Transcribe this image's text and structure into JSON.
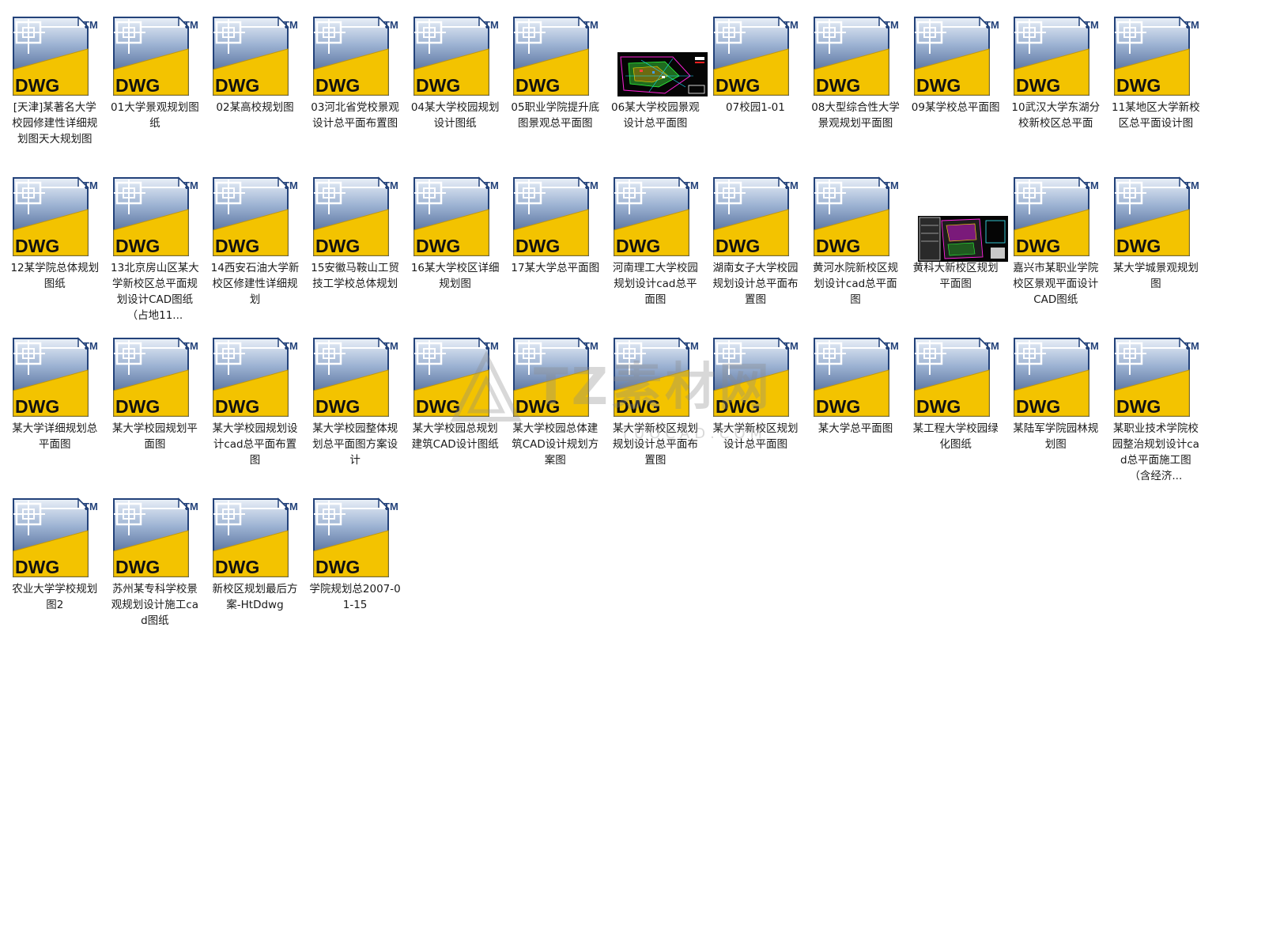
{
  "icon": {
    "badge": "DWG",
    "trademark": "TM",
    "accent": "#f3c300",
    "frame": "#29457a"
  },
  "files": [
    {
      "name": "[天津]某著名大学校园修建性详细规划图天大规划图",
      "thumb": false
    },
    {
      "name": "01大学景观规划图纸",
      "thumb": false
    },
    {
      "name": "02某高校规划图",
      "thumb": false
    },
    {
      "name": "03河北省党校景观设计总平面布置图",
      "thumb": false
    },
    {
      "name": "04某大学校园规划设计图纸",
      "thumb": false
    },
    {
      "name": "05职业学院提升底图景观总平面图",
      "thumb": false
    },
    {
      "name": "06某大学校园景观设计总平面图",
      "thumb": true
    },
    {
      "name": "07校园1-01",
      "thumb": false
    },
    {
      "name": "08大型综合性大学景观规划平面图",
      "thumb": false
    },
    {
      "name": "09某学校总平面图",
      "thumb": false
    },
    {
      "name": "10武汉大学东湖分校新校区总平面",
      "thumb": false
    },
    {
      "name": "11某地区大学新校区总平面设计图",
      "thumb": false
    },
    {
      "name": "12某学院总体规划图纸",
      "thumb": false
    },
    {
      "name": "13北京房山区某大学新校区总平面规划设计CAD图纸（占地11...",
      "thumb": false
    },
    {
      "name": "14西安石油大学新校区修建性详细规划",
      "thumb": false
    },
    {
      "name": "15安徽马鞍山工贸技工学校总体规划",
      "thumb": false
    },
    {
      "name": "16某大学校区详细规划图",
      "thumb": false
    },
    {
      "name": "17某大学总平面图",
      "thumb": false
    },
    {
      "name": "河南理工大学校园规划设计cad总平面图",
      "thumb": false
    },
    {
      "name": "湖南女子大学校园规划设计总平面布置图",
      "thumb": false
    },
    {
      "name": "黄河水院新校区规划设计cad总平面图",
      "thumb": false
    },
    {
      "name": "黄科大新校区规划平面图",
      "thumb": true
    },
    {
      "name": "嘉兴市某职业学院校区景观平面设计CAD图纸",
      "thumb": false
    },
    {
      "name": "某大学城景观规划图",
      "thumb": false
    },
    {
      "name": "某大学详细规划总平面图",
      "thumb": false
    },
    {
      "name": "某大学校园规划平面图",
      "thumb": false
    },
    {
      "name": "某大学校园规划设计cad总平面布置图",
      "thumb": false
    },
    {
      "name": "某大学校园整体规划总平面图方案设计",
      "thumb": false
    },
    {
      "name": "某大学校园总规划建筑CAD设计图纸",
      "thumb": false
    },
    {
      "name": "某大学校园总体建筑CAD设计规划方案图",
      "thumb": false
    },
    {
      "name": "某大学新校区规划规划设计总平面布置图",
      "thumb": false
    },
    {
      "name": "某大学新校区规划设计总平面图",
      "thumb": false
    },
    {
      "name": "某大学总平面图",
      "thumb": false
    },
    {
      "name": "某工程大学校园绿化图纸",
      "thumb": false
    },
    {
      "name": "某陆军学院园林规划图",
      "thumb": false
    },
    {
      "name": "某职业技术学院校园整治规划设计cad总平面施工图（含经济...",
      "thumb": false
    },
    {
      "name": "农业大学学校规划图2",
      "thumb": false
    },
    {
      "name": "苏州某专科学校景观规划设计施工cad图纸",
      "thumb": false
    },
    {
      "name": "新校区规划最后方案-HtDdwg",
      "thumb": false
    },
    {
      "name": "学院规划总2007-01-15",
      "thumb": false
    }
  ],
  "watermark": {
    "text": "TZ素材网",
    "sub": "TUOCAD.COM"
  }
}
